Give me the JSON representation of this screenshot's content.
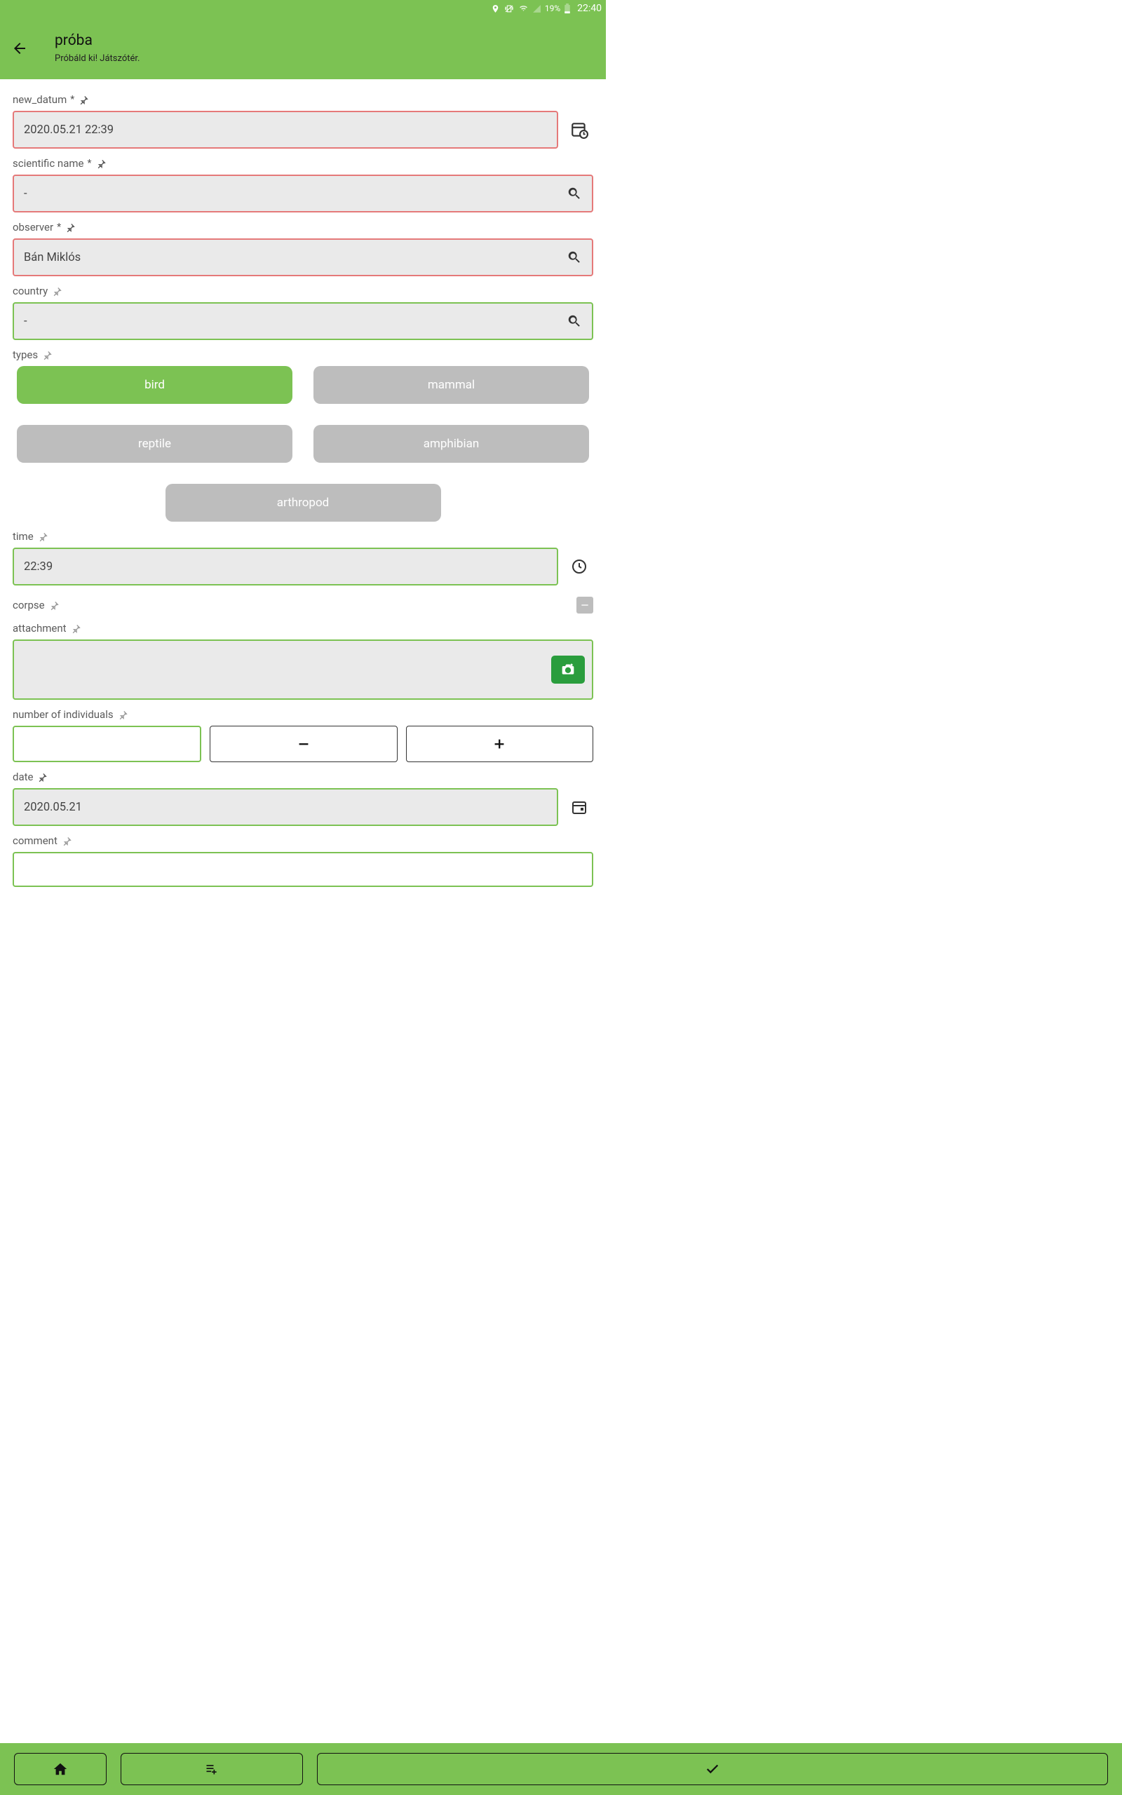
{
  "statusbar": {
    "battery_text": "19%",
    "clock": "22:40"
  },
  "appbar": {
    "title": "próba",
    "subtitle": "Próbáld ki! Játszótér."
  },
  "fields": {
    "new_datum": {
      "label": "new_datum",
      "required": true,
      "value": "2020.05.21 22:39"
    },
    "scientific": {
      "label": "scientific name",
      "required": true,
      "value": "-"
    },
    "observer": {
      "label": "observer",
      "required": true,
      "value": "Bán Miklós"
    },
    "country": {
      "label": "country",
      "required": false,
      "value": "-"
    },
    "types": {
      "label": "types",
      "options": [
        "bird",
        "mammal",
        "reptile",
        "amphibian",
        "arthropod"
      ],
      "selected": "bird"
    },
    "time": {
      "label": "time",
      "value": "22:39"
    },
    "corpse": {
      "label": "corpse"
    },
    "attachment": {
      "label": "attachment"
    },
    "noi": {
      "label": "number of individuals",
      "value": ""
    },
    "date": {
      "label": "date",
      "value": "2020.05.21"
    },
    "comment": {
      "label": "comment"
    }
  }
}
